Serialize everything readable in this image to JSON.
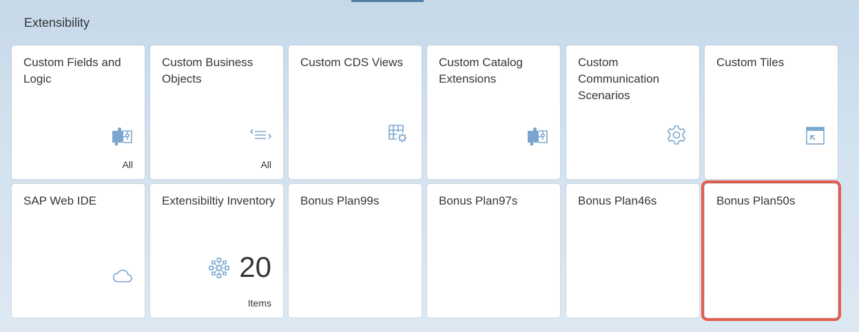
{
  "group": {
    "title": "Extensibility"
  },
  "tiles": [
    {
      "title": "Custom Fields and Logic",
      "footer": "All"
    },
    {
      "title": "Custom Business Objects",
      "footer": "All"
    },
    {
      "title": "Custom CDS Views"
    },
    {
      "title": "Custom Catalog Extensions"
    },
    {
      "title": "Custom Communication Scenarios"
    },
    {
      "title": "Custom Tiles"
    },
    {
      "title": "SAP Web IDE"
    },
    {
      "title": "Extensibiltiy Inventory",
      "kpi": "20",
      "footer": "Items"
    },
    {
      "title": "Bonus Plan99s"
    },
    {
      "title": "Bonus Plan97s"
    },
    {
      "title": "Bonus Plan46s"
    },
    {
      "title": "Bonus Plan50s"
    }
  ],
  "colors": {
    "icon": "#7ba7cf",
    "highlight": "#e35d4f",
    "text": "#32363a"
  },
  "icons": [
    "puzzle-icon",
    "business-objects-icon",
    "table-settings-icon",
    "puzzle-icon",
    "gear-icon",
    "tile-window-icon",
    "cloud-icon",
    "network-icon"
  ]
}
